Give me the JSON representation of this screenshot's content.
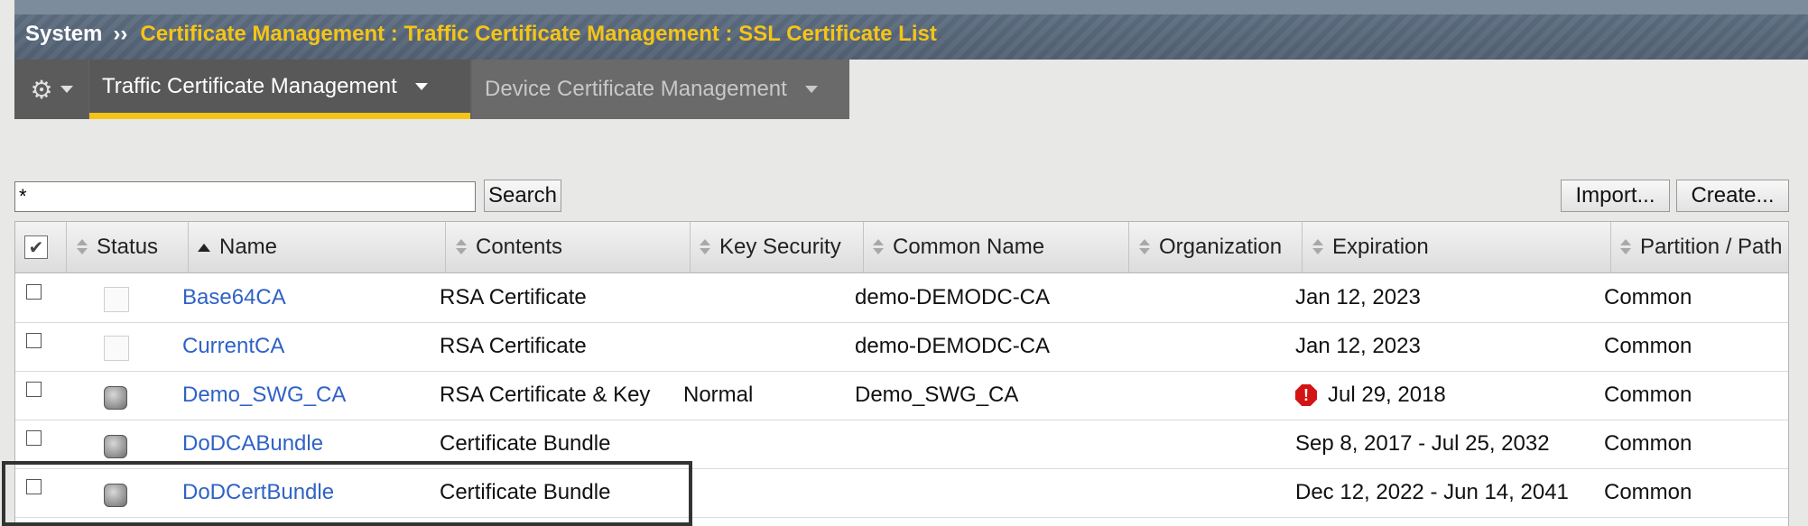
{
  "titlebar": {
    "system": "System",
    "separator": "››",
    "path": "Certificate Management : Traffic Certificate Management : SSL Certificate List"
  },
  "tabs": {
    "gear_icon": "gear-icon",
    "traffic": "Traffic Certificate Management",
    "device": "Device Certificate Management"
  },
  "toolbar": {
    "search_value": "*",
    "search_label": "Search",
    "import_label": "Import...",
    "create_label": "Create..."
  },
  "table": {
    "columns": {
      "status": "Status",
      "name": "Name",
      "contents": "Contents",
      "key_security": "Key Security",
      "common_name": "Common Name",
      "organization": "Organization",
      "expiration": "Expiration",
      "partition": "Partition / Path"
    },
    "rows": [
      {
        "status": "empty",
        "name": "Base64CA",
        "contents": "RSA Certificate",
        "key_security": "",
        "common_name": "demo-DEMODC-CA",
        "organization": "",
        "expiration": "Jan 12, 2023",
        "warning": false,
        "partition": "Common"
      },
      {
        "status": "empty",
        "name": "CurrentCA",
        "contents": "RSA Certificate",
        "key_security": "",
        "common_name": "demo-DEMODC-CA",
        "organization": "",
        "expiration": "Jan 12, 2023",
        "warning": false,
        "partition": "Common"
      },
      {
        "status": "gray",
        "name": "Demo_SWG_CA",
        "contents": "RSA Certificate & Key",
        "key_security": "Normal",
        "common_name": "Demo_SWG_CA",
        "organization": "",
        "expiration": "Jul 29, 2018",
        "warning": true,
        "partition": "Common"
      },
      {
        "status": "gray",
        "name": "DoDCABundle",
        "contents": "Certificate Bundle",
        "key_security": "",
        "common_name": "",
        "organization": "",
        "expiration": "Sep 8, 2017 - Jul 25, 2032",
        "warning": false,
        "partition": "Common"
      },
      {
        "status": "gray",
        "name": "DoDCertBundle",
        "contents": "Certificate Bundle",
        "key_security": "",
        "common_name": "",
        "organization": "",
        "expiration": "Dec 12, 2022 - Jun 14, 2041",
        "warning": false,
        "partition": "Common"
      }
    ]
  },
  "colors": {
    "accent": "#f5c417",
    "link": "#2f62c7",
    "warning": "#d41414"
  }
}
